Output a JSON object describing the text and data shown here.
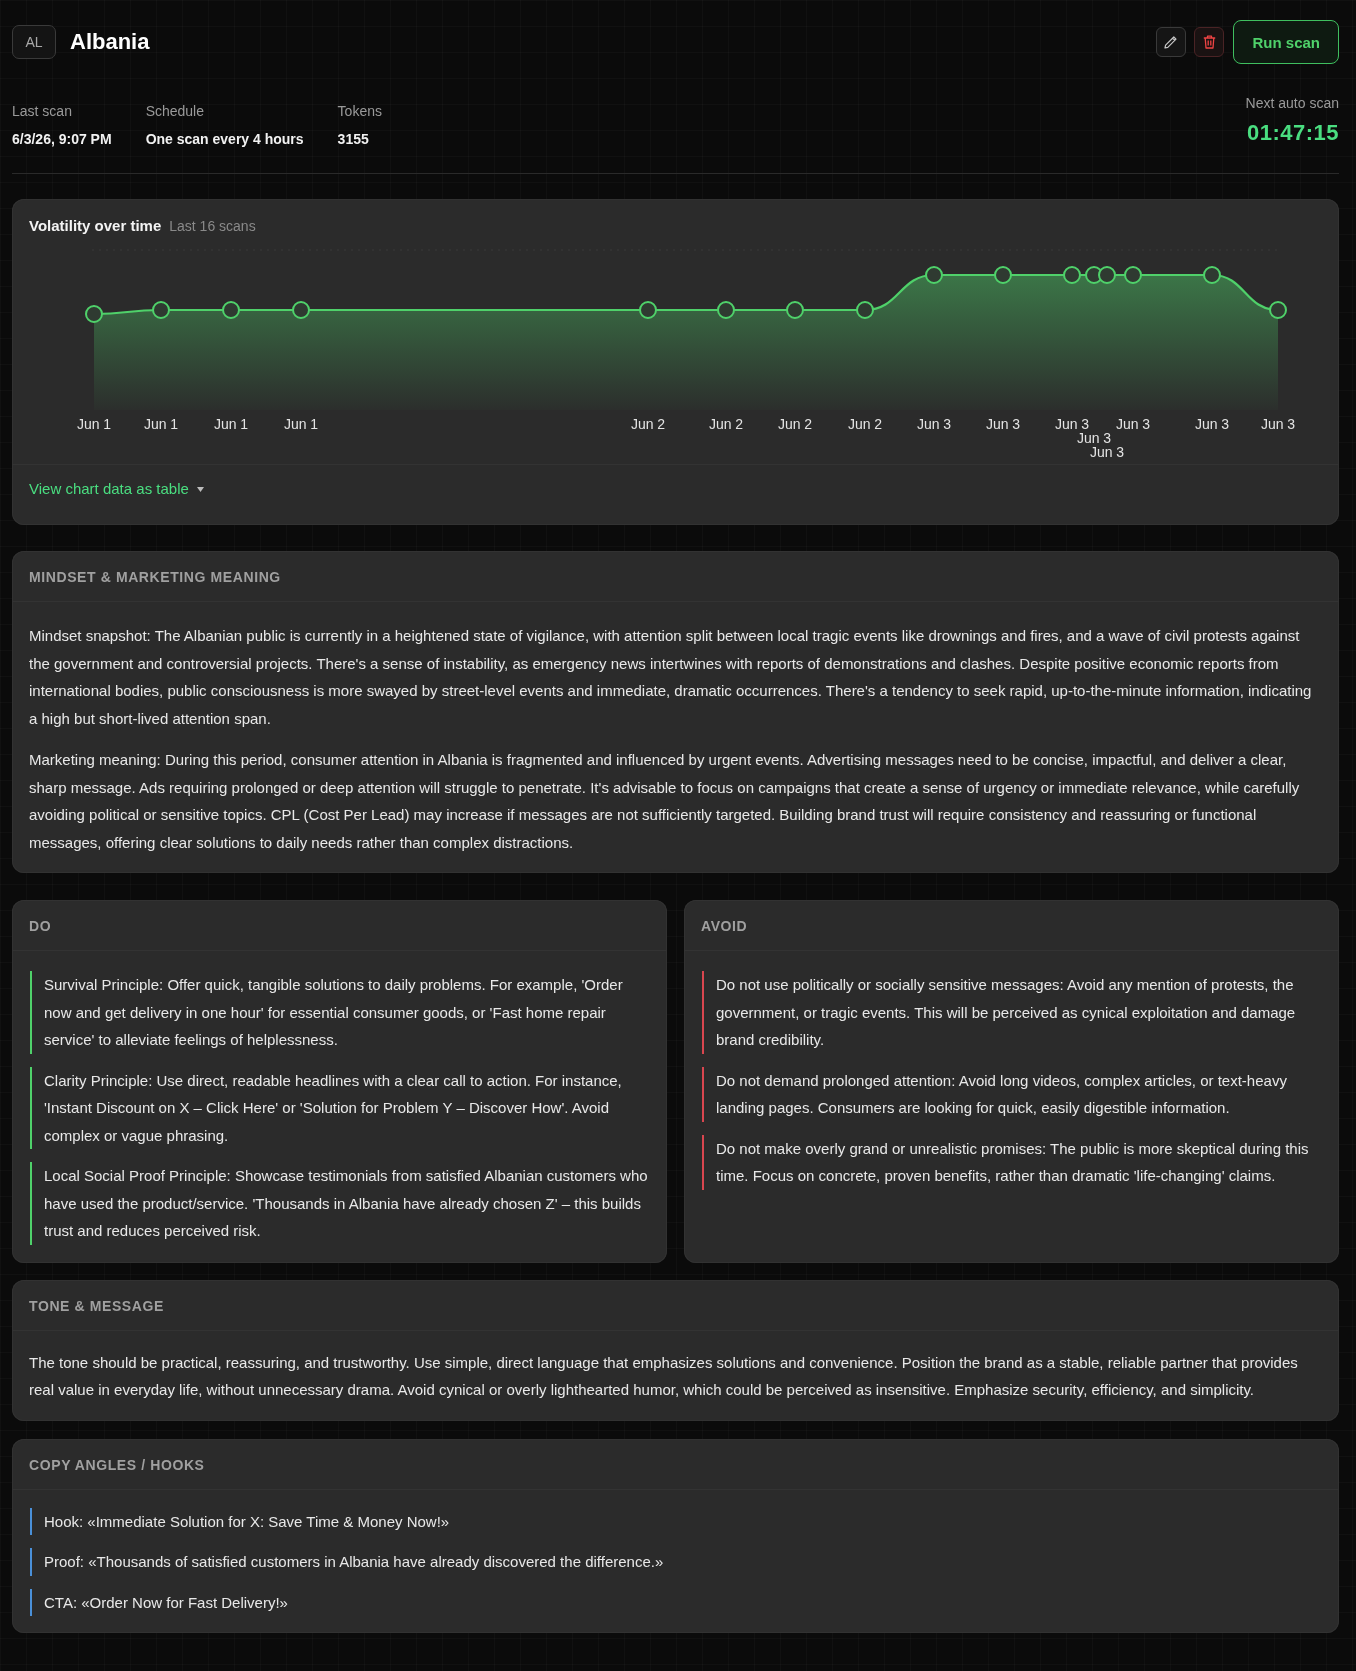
{
  "header": {
    "badge": "AL",
    "title": "Albania",
    "run_button": "Run scan"
  },
  "stats": [
    {
      "label": "Last scan",
      "value": "6/3/26, 9:07 PM"
    },
    {
      "label": "Schedule",
      "value": "One scan every 4 hours"
    },
    {
      "label": "Tokens",
      "value": "3155"
    }
  ],
  "next_scan": {
    "label": "Next auto scan",
    "countdown": "01:47:15"
  },
  "chart": {
    "title": "Volatility over time",
    "subtitle": "Last 16 scans",
    "x_labels": [
      "Jun 1",
      "Jun 1",
      "Jun 1",
      "Jun 1",
      "Jun 2",
      "Jun 2",
      "Jun 2",
      "Jun 2",
      "Jun 3",
      "Jun 3",
      "Jun 3",
      "Jun 3",
      "Jun 3",
      "Jun 3",
      "Jun 3",
      "Jun 3"
    ],
    "toggle": "View chart data as table"
  },
  "mindset": {
    "heading": "MINDSET & MARKETING MEANING",
    "paragraphs": [
      "Mindset snapshot: The Albanian public is currently in a heightened state of vigilance, with attention split between local tragic events like drownings and fires, and a wave of civil protests against the government and controversial projects. There's a sense of instability, as emergency news intertwines with reports of demonstrations and clashes. Despite positive economic reports from international bodies, public consciousness is more swayed by street-level events and immediate, dramatic occurrences. There's a tendency to seek rapid, up-to-the-minute information, indicating a high but short-lived attention span.",
      "Marketing meaning: During this period, consumer attention in Albania is fragmented and influenced by urgent events. Advertising messages need to be concise, impactful, and deliver a clear, sharp message. Ads requiring prolonged or deep attention will struggle to penetrate. It's advisable to focus on campaigns that create a sense of urgency or immediate relevance, while carefully avoiding political or sensitive topics. CPL (Cost Per Lead) may increase if messages are not sufficiently targeted. Building brand trust will require consistency and reassuring or functional messages, offering clear solutions to daily needs rather than complex distractions."
    ]
  },
  "do": {
    "heading": "DO",
    "items": [
      "Survival Principle: Offer quick, tangible solutions to daily problems. For example, 'Order now and get delivery in one hour' for essential consumer goods, or 'Fast home repair service' to alleviate feelings of helplessness.",
      "Clarity Principle: Use direct, readable headlines with a clear call to action. For instance, 'Instant Discount on X – Click Here' or 'Solution for Problem Y – Discover How'. Avoid complex or vague phrasing.",
      "Local Social Proof Principle: Showcase testimonials from satisfied Albanian customers who have used the product/service. 'Thousands in Albania have already chosen Z' – this builds trust and reduces perceived risk."
    ]
  },
  "avoid": {
    "heading": "AVOID",
    "items": [
      "Do not use politically or socially sensitive messages: Avoid any mention of protests, the government, or tragic events. This will be perceived as cynical exploitation and damage brand credibility.",
      "Do not demand prolonged attention: Avoid long videos, complex articles, or text-heavy landing pages. Consumers are looking for quick, easily digestible information.",
      "Do not make overly grand or unrealistic promises: The public is more skeptical during this time. Focus on concrete, proven benefits, rather than dramatic 'life-changing' claims."
    ]
  },
  "tone": {
    "heading": "TONE & MESSAGE",
    "paragraphs": [
      "The tone should be practical, reassuring, and trustworthy. Use simple, direct language that emphasizes solutions and convenience. Position the brand as a stable, reliable partner that provides real value in everyday life, without unnecessary drama. Avoid cynical or overly lighthearted humor, which could be perceived as insensitive. Emphasize security, efficiency, and simplicity."
    ]
  },
  "hooks": {
    "heading": "COPY ANGLES / HOOKS",
    "items": [
      "Hook: «Immediate Solution for X: Save Time & Money Now!»",
      "Proof: «Thousands of satisfied customers in Albania have already discovered the difference.»",
      "CTA: «Order Now for Fast Delivery!»"
    ]
  }
}
